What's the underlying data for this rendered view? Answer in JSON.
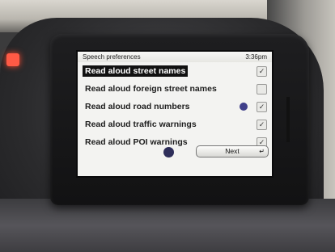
{
  "window": {
    "title": "Speech preferences",
    "time": "3:36pm"
  },
  "options": [
    {
      "label": "Read aloud street names",
      "checked": true,
      "selected": true
    },
    {
      "label": "Read aloud foreign street names",
      "checked": false,
      "selected": false
    },
    {
      "label": "Read aloud road numbers",
      "checked": true,
      "selected": false
    },
    {
      "label": "Read aloud traffic warnings",
      "checked": true,
      "selected": false
    },
    {
      "label": "Read aloud POI warnings",
      "checked": true,
      "selected": false
    }
  ],
  "check_glyph": "✓",
  "next_button": {
    "label": "Next",
    "icon": "return-arrow-icon",
    "glyph": "↵"
  },
  "colors": {
    "screen_bg": "#f3f3f1",
    "selection_bg": "#111111",
    "hazard": "#ff5a45"
  }
}
